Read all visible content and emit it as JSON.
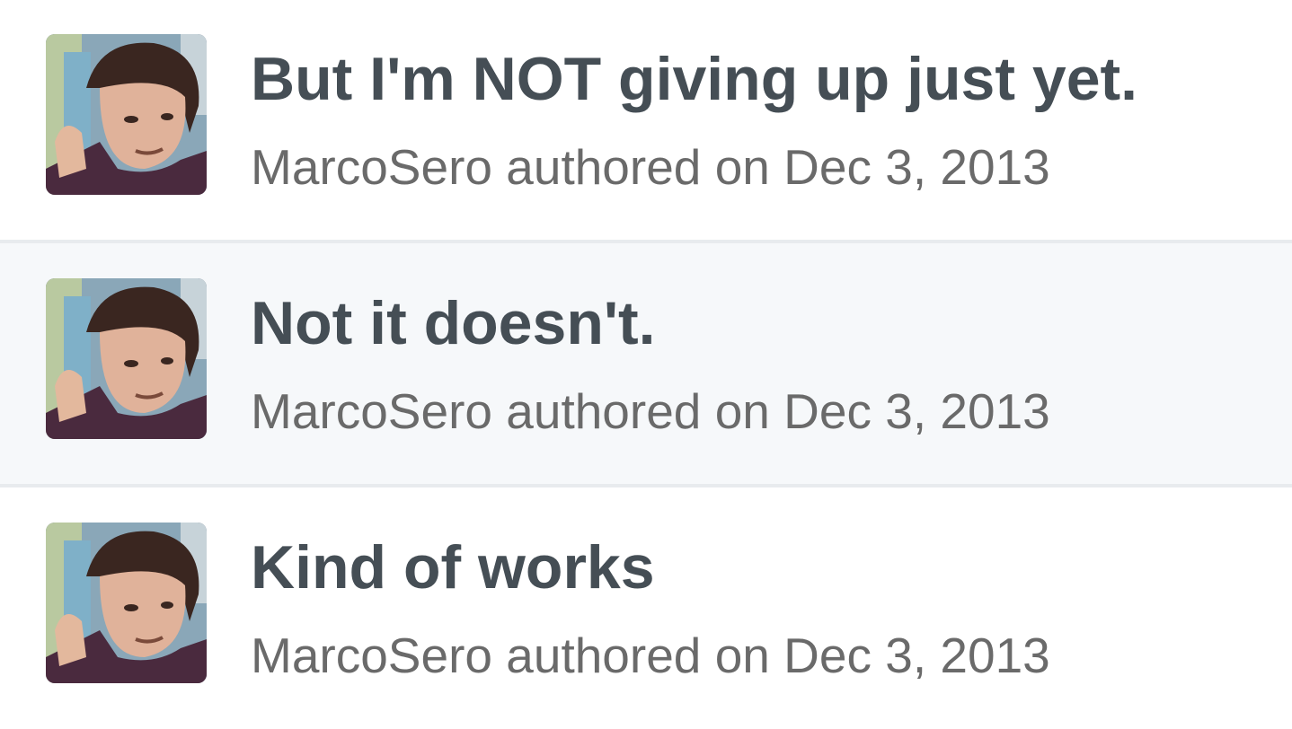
{
  "commits": [
    {
      "message": "But I'm NOT giving up just yet.",
      "author": "MarcoSero",
      "action": "authored",
      "on": "on",
      "date": "Dec 3, 2013"
    },
    {
      "message": "Not it doesn't.",
      "author": "MarcoSero",
      "action": "authored",
      "on": "on",
      "date": "Dec 3, 2013"
    },
    {
      "message": "Kind of works",
      "author": "MarcoSero",
      "action": "authored",
      "on": "on",
      "date": "Dec 3, 2013"
    }
  ],
  "avatar_icon": "user-avatar-photo",
  "colors": {
    "message_text": "#454e55",
    "meta_text": "#6a6a6a",
    "highlight_row": "#f6f8fa",
    "divider": "#e8ebee"
  }
}
